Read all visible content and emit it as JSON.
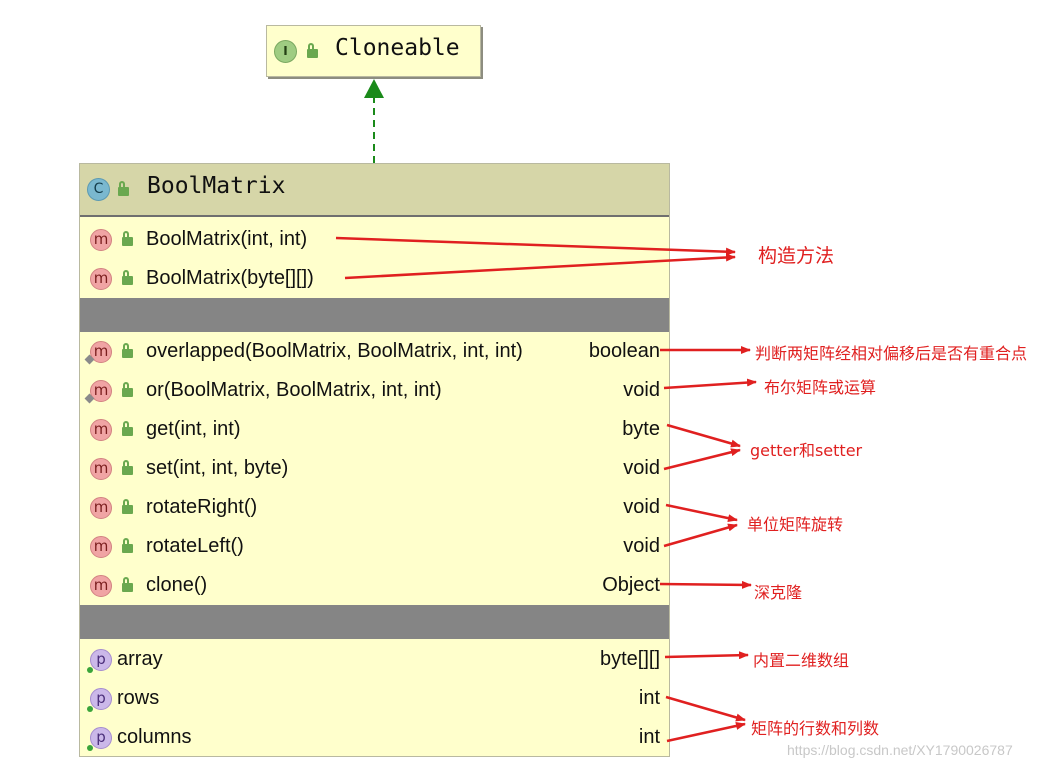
{
  "interface": {
    "stereotype_icon": "I",
    "name": "Cloneable"
  },
  "class": {
    "stereotype_icon": "C",
    "name": "BoolMatrix",
    "constructors": [
      {
        "icon": "m",
        "name": "BoolMatrix(int, int)"
      },
      {
        "icon": "m",
        "name": "BoolMatrix(byte[][])"
      }
    ],
    "methods": [
      {
        "icon": "m",
        "name": "overlapped(BoolMatrix, BoolMatrix, int, int)",
        "type": "boolean"
      },
      {
        "icon": "m",
        "name": "or(BoolMatrix, BoolMatrix, int, int)",
        "type": "void"
      },
      {
        "icon": "m",
        "name": "get(int, int)",
        "type": "byte"
      },
      {
        "icon": "m",
        "name": "set(int, int, byte)",
        "type": "void"
      },
      {
        "icon": "m",
        "name": "rotateRight()",
        "type": "void"
      },
      {
        "icon": "m",
        "name": "rotateLeft()",
        "type": "void"
      },
      {
        "icon": "m",
        "name": "clone()",
        "type": "Object"
      }
    ],
    "properties": [
      {
        "icon": "p",
        "name": "array",
        "type": "byte[][]"
      },
      {
        "icon": "p",
        "name": "rows",
        "type": "int"
      },
      {
        "icon": "p",
        "name": "columns",
        "type": "int"
      }
    ]
  },
  "annotations": {
    "constructors": "构造方法",
    "overlapped": "判断两矩阵经相对偏移后是否有重合点",
    "or": "布尔矩阵或运算",
    "getset": "getter和setter",
    "rotate": "单位矩阵旋转",
    "clone": "深克隆",
    "array": "内置二维数组",
    "rowscols": "矩阵的行数和列数"
  },
  "watermark": "https://blog.csdn.net/XY1790026787",
  "colors": {
    "box_fill": "#ffffcc",
    "header_fill": "#d6d6a8",
    "separator": "#858585",
    "inherit_arrow": "#1a8a1a",
    "annotation": "#e02020"
  }
}
